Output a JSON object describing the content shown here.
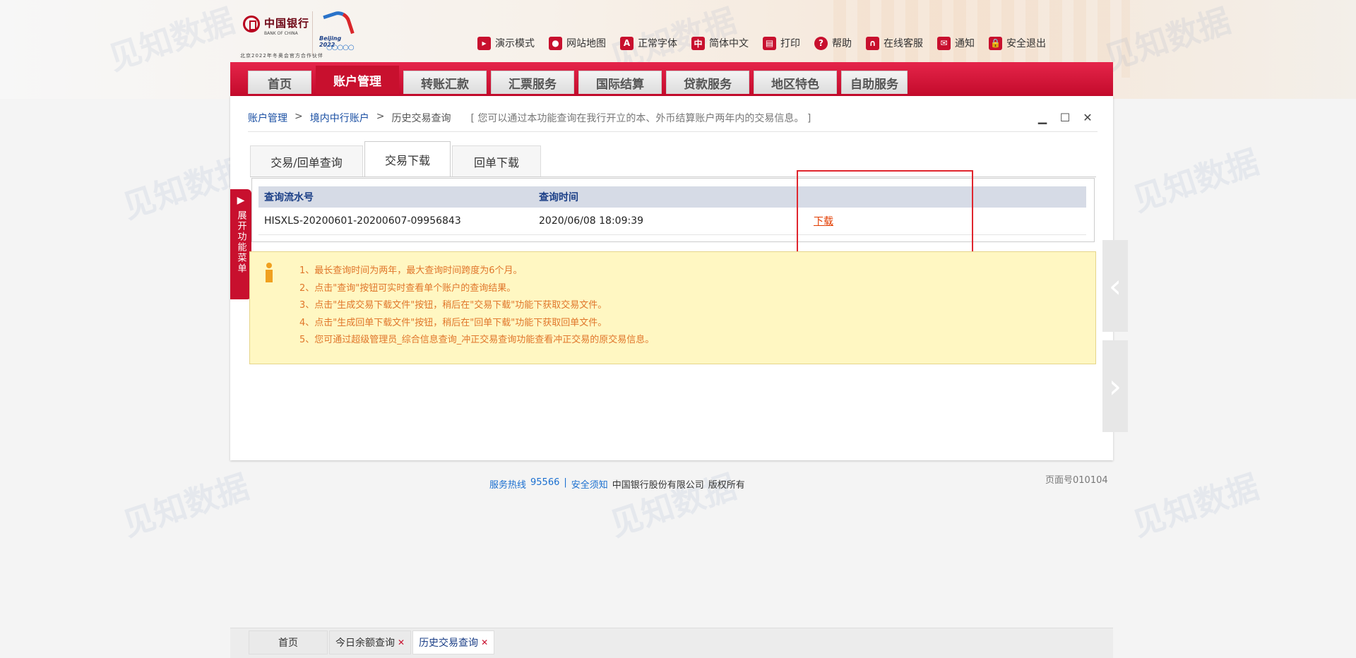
{
  "brand": {
    "bank_name": "中国银行",
    "bank_en": "BANK OF CHINA",
    "olympic_text": "Beijing 2022",
    "sponsor_text": "北京2022年冬奥会官方合作伙伴"
  },
  "top_links": [
    {
      "label": "演示模式",
      "icon": "play-icon"
    },
    {
      "label": "网站地图",
      "icon": "location-icon"
    },
    {
      "label": "正常字体",
      "icon": "font-icon"
    },
    {
      "label": "简体中文",
      "icon": "language-icon"
    },
    {
      "label": "打印",
      "icon": "print-icon"
    },
    {
      "label": "帮助",
      "icon": "help-icon"
    },
    {
      "label": "在线客服",
      "icon": "headset-icon"
    },
    {
      "label": "通知",
      "icon": "mail-icon"
    },
    {
      "label": "安全退出",
      "icon": "lock-icon"
    }
  ],
  "nav": {
    "tabs": [
      "首页",
      "账户管理",
      "转账汇款",
      "汇票服务",
      "国际结算",
      "贷款服务",
      "地区特色",
      "自助服务"
    ],
    "active_index": 1
  },
  "breadcrumb": {
    "items": [
      "账户管理",
      "境内中行账户",
      "历史交易查询"
    ],
    "hint": "[ 您可以通过本功能查询在我行开立的本、外币结算账户两年内的交易信息。 ]"
  },
  "sub_tabs": {
    "items": [
      "交易/回单查询",
      "交易下载",
      "回单下载"
    ],
    "active_index": 1
  },
  "side_menu": {
    "label": "展开功能菜单"
  },
  "table": {
    "headers": [
      "查询流水号",
      "查询时间",
      ""
    ],
    "rows": [
      {
        "serial": "HISXLS-20200601-20200607-09956843",
        "time": "2020/06/08 18:09:39",
        "action": "下载"
      }
    ]
  },
  "notes": [
    "1、最长查询时间为两年，最大查询时间跨度为6个月。",
    "2、点击\"查询\"按钮可实时查看单个账户的查询结果。",
    "3、点击\"生成交易下载文件\"按钮，稍后在\"交易下载\"功能下获取交易文件。",
    "4、点击\"生成回单下载文件\"按钮，稍后在\"回单下载\"功能下获取回单文件。",
    "5、您可通过超级管理员_综合信息查询_冲正交易查询功能查看冲正交易的原交易信息。"
  ],
  "footer": {
    "hotline_label": "服务热线",
    "hotline": "95566",
    "sep": "|",
    "security_label": "安全须知",
    "company": "中国银行股份有限公司",
    "rights": "版权所有",
    "page_no": "页面号010104"
  },
  "task_tabs": {
    "items": [
      "首页",
      "今日余额查询",
      "历史交易查询"
    ],
    "active_index": 2
  },
  "watermark": "见知数据",
  "colors": {
    "brand_red": "#c8102e",
    "link_blue": "#1a4fa3",
    "download_orange": "#e23c00",
    "note_bg": "#fff7c2",
    "note_text": "#e0762a",
    "highlight_red": "#e0262e"
  }
}
